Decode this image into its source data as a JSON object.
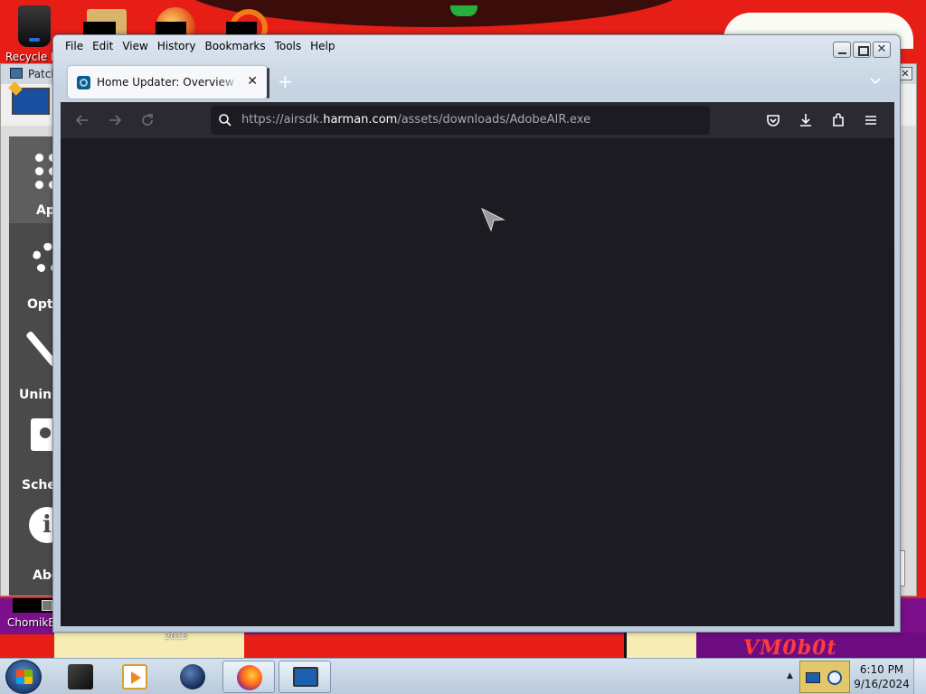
{
  "desktop": {
    "icons": [
      {
        "label": "Recycle Bin"
      },
      {
        "label": "ChomikBox"
      }
    ],
    "wallpaper_text": "VM0b0t",
    "wallpaper_year": "2015"
  },
  "patch_window": {
    "title": "Patch",
    "close_label": "✕",
    "sidebar": [
      {
        "label": "Apps",
        "icon": "grid-dots-icon"
      },
      {
        "label": "Options",
        "icon": "gear-icon"
      },
      {
        "label": "Uninstall",
        "icon": "wrench-icon"
      },
      {
        "label": "Schedule",
        "icon": "calendar-icon"
      },
      {
        "label": "About",
        "icon": "info-icon"
      }
    ]
  },
  "firefox": {
    "menu": [
      {
        "label": "File"
      },
      {
        "label": "Edit"
      },
      {
        "label": "View"
      },
      {
        "label": "History"
      },
      {
        "label": "Bookmarks"
      },
      {
        "label": "Tools"
      },
      {
        "label": "Help"
      }
    ],
    "tab": {
      "title": "Home Updater: Overview and Downloads",
      "close": "✕"
    },
    "new_tab": "+",
    "url": {
      "prefix": "https://airsdk.",
      "domain": "harman.com",
      "path": "/assets/downloads/AdobeAIR.exe"
    },
    "window_controls": {
      "close": "✕"
    }
  },
  "taskbar": {
    "apps": [
      "cube-app-icon",
      "media-player-icon",
      "globe-app-icon",
      "firefox-icon",
      "monitor-app-icon"
    ],
    "clock_time": "6:10 PM",
    "clock_date": "9/16/2024"
  }
}
